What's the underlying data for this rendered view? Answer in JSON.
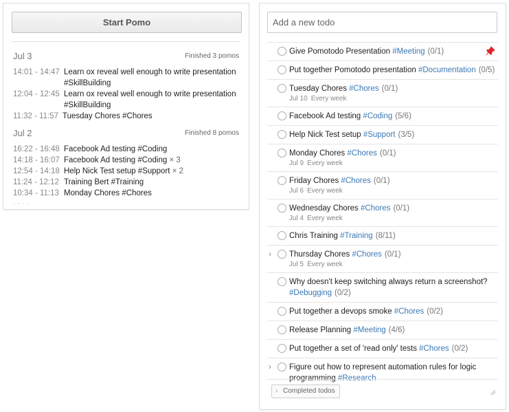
{
  "left": {
    "start_button": "Start Pomo",
    "days": [
      {
        "date": "Jul 3",
        "summary": "Finished 3 pomos",
        "entries": [
          {
            "time": "14:01 - 14:47",
            "text": "Learn ox reveal well enough to write presentation #SkillBuilding"
          },
          {
            "time": "12:04 - 12:45",
            "text": "Learn ox reveal well enough to write presentation #SkillBuilding"
          },
          {
            "time": "11:32 - 11:57",
            "text": "Tuesday Chores #Chores"
          }
        ]
      },
      {
        "date": "Jul 2",
        "summary": "Finished 8 pomos",
        "entries": [
          {
            "time": "16:22 - 16:48",
            "text": "Facebook Ad testing #Coding",
            "mult": ""
          },
          {
            "time": "14:18 - 16:07",
            "text": "Facebook Ad testing #Coding",
            "mult": "× 3"
          },
          {
            "time": "12:54 - 14:18",
            "text": "Help Nick Test setup #Support",
            "mult": "× 2"
          },
          {
            "time": "11:24 - 12:12",
            "text": "Training Bert #Training",
            "mult": ""
          },
          {
            "time": "10:34 - 11:13",
            "text": "Monday Chores #Chores",
            "mult": ""
          }
        ],
        "partial": "· ·  · ·"
      }
    ]
  },
  "right": {
    "input_placeholder": "Add a new todo",
    "todos": [
      {
        "title": "Give Pomotodo Presentation",
        "tag": "#Meeting",
        "count": "(0/1)"
      },
      {
        "title": "Put together Pomotodo presentation",
        "tag": "#Documentation",
        "count": "(0/5)"
      },
      {
        "title": "Tuesday Chores",
        "tag": "#Chores",
        "count": "(0/1)",
        "date": "Jul 10",
        "repeat": "Every week"
      },
      {
        "title": "Facebook Ad testing",
        "tag": "#Coding",
        "count": "(5/6)"
      },
      {
        "title": "Help Nick Test setup",
        "tag": "#Support",
        "count": "(3/5)"
      },
      {
        "title": "Monday Chores",
        "tag": "#Chores",
        "count": "(0/1)",
        "date": "Jul 9",
        "repeat": "Every week"
      },
      {
        "title": "Friday Chores",
        "tag": "#Chores",
        "count": "(0/1)",
        "date": "Jul 6",
        "repeat": "Every week"
      },
      {
        "title": "Wednesday Chores",
        "tag": "#Chores",
        "count": "(0/1)",
        "date": "Jul 4",
        "repeat": "Every week"
      },
      {
        "title": "Chris Training",
        "tag": "#Training",
        "count": "(8/11)"
      },
      {
        "title": "Thursday Chores",
        "tag": "#Chores",
        "count": "(0/1)",
        "date": "Jul 5",
        "repeat": "Every week"
      },
      {
        "title": "Why doesn't keep switching always return a screenshot?",
        "tag": "#Debugging",
        "count": "(0/2)"
      },
      {
        "title": "Put together a devops smoke",
        "tag": "#Chores",
        "count": "(0/2)"
      },
      {
        "title": "Release Planning",
        "tag": "#Meeting",
        "count": "(4/6)"
      },
      {
        "title": "Put together a set of 'read only' tests",
        "tag": "#Chores",
        "count": "(0/2)"
      },
      {
        "title": "Figure out how to represent automation rules for logic programming",
        "tag": "#Research",
        "count": ""
      }
    ],
    "completed_button": "Completed todos"
  },
  "colors": {
    "tag": "#3b78b5",
    "pin": "#e0262c"
  },
  "icons": {
    "pin": "pin-icon",
    "expand": "chevron-right-icon",
    "resize": "resize-handle-icon"
  }
}
